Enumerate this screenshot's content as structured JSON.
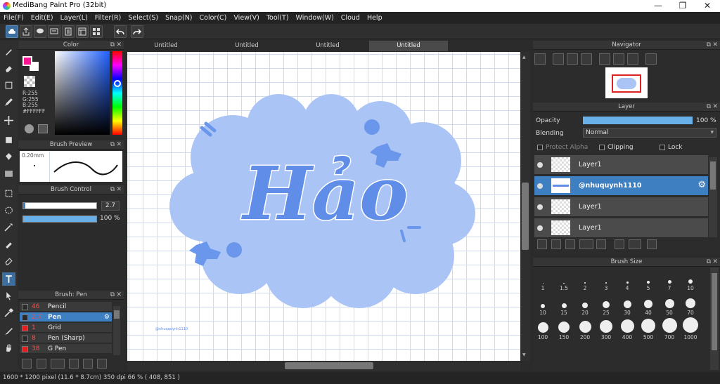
{
  "window": {
    "title": "MediBang Paint Pro (32bit)",
    "minimize": "—",
    "maximize": "❐",
    "close": "✕"
  },
  "menu": [
    "File(F)",
    "Edit(E)",
    "Layer(L)",
    "Filter(R)",
    "Select(S)",
    "Snap(N)",
    "Color(C)",
    "View(V)",
    "Tool(T)",
    "Window(W)",
    "Cloud",
    "Help"
  ],
  "tabs": [
    "Untitled",
    "Untitled",
    "Untitled",
    "Untitled"
  ],
  "color_panel": {
    "title": "Color",
    "r": "R:255",
    "g": "G:255",
    "b": "B:255",
    "hex": "#FFFFFF",
    "fg": "#ff1493",
    "bg": "#ffffff"
  },
  "brush_preview": {
    "title": "Brush Preview",
    "size": "0.20mm"
  },
  "brush_control": {
    "title": "Brush Control",
    "size": "2.7",
    "opacity": "100 %",
    "opacity_value": 100
  },
  "brush_list": {
    "title": "Brush: Pen",
    "items": [
      {
        "num": "46",
        "name": "Pencil",
        "color": "#2a2a2a"
      },
      {
        "num": "2.7",
        "name": "Pen",
        "color": "#2a2a2a"
      },
      {
        "num": "1",
        "name": "Grid",
        "color": "#e02020"
      },
      {
        "num": "8",
        "name": "Pen (Sharp)",
        "color": "#2a2a2a"
      },
      {
        "num": "38",
        "name": "G Pen",
        "color": "#e02020"
      }
    ]
  },
  "artwork": {
    "text": "Hảo",
    "signature": "@nhuqquynh1110"
  },
  "navigator": {
    "title": "Navigator"
  },
  "layer_panel": {
    "title": "Layer",
    "opacity_label": "Opacity",
    "opacity": "100 %",
    "opacity_value": 100,
    "blending_label": "Blending",
    "blending": "Normal",
    "protect_alpha": "Protect Alpha",
    "clipping": "Clipping",
    "lock": "Lock",
    "layers": [
      "Layer1",
      "@nhuquynh1110",
      "Layer1",
      "Layer1"
    ]
  },
  "brush_size": {
    "title": "Brush Size",
    "sizes": [
      "1",
      "1.5",
      "2",
      "3",
      "4",
      "5",
      "7",
      "10",
      "10",
      "15",
      "20",
      "25",
      "30",
      "40",
      "50",
      "70",
      "100",
      "150",
      "200",
      "300",
      "400",
      "500",
      "700",
      "1000"
    ]
  },
  "status": "1600 * 1200 pixel   (11.6 * 8.7cm)  350 dpi   66 %   ( 408, 851 )",
  "colors": {
    "accent": "#3d7fc1",
    "cloud": "#a9c4f5",
    "letters": "#5f8de8"
  }
}
